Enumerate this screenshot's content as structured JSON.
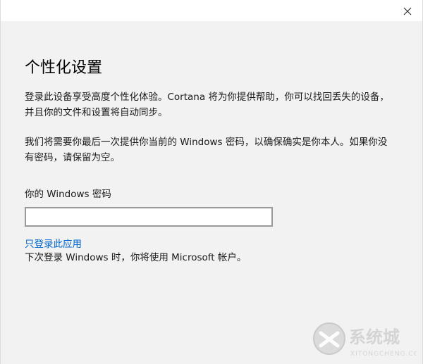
{
  "window": {
    "close_icon": "close-icon",
    "accent_link_color": "#0066cc"
  },
  "dialog": {
    "title": "个性化设置",
    "paragraph1": "登录此设备享受高度个性化体验。Cortana 将为你提供帮助，你可以找回丢失的设备，并且你的文件和设置将自动同步。",
    "paragraph2": "我们将需要你最后一次提供你当前的 Windows 密码，以确保确实是你本人。如果你没有密码，请保留为空。",
    "password_label": "你的 Windows 密码",
    "password_value": "",
    "link_label": "只登录此应用",
    "note": "下次登录 Windows 时，你将使用 Microsoft 帐户。"
  },
  "watermark": {
    "brand": "系统城",
    "pinyin": "XITONGCHENG.COM"
  }
}
